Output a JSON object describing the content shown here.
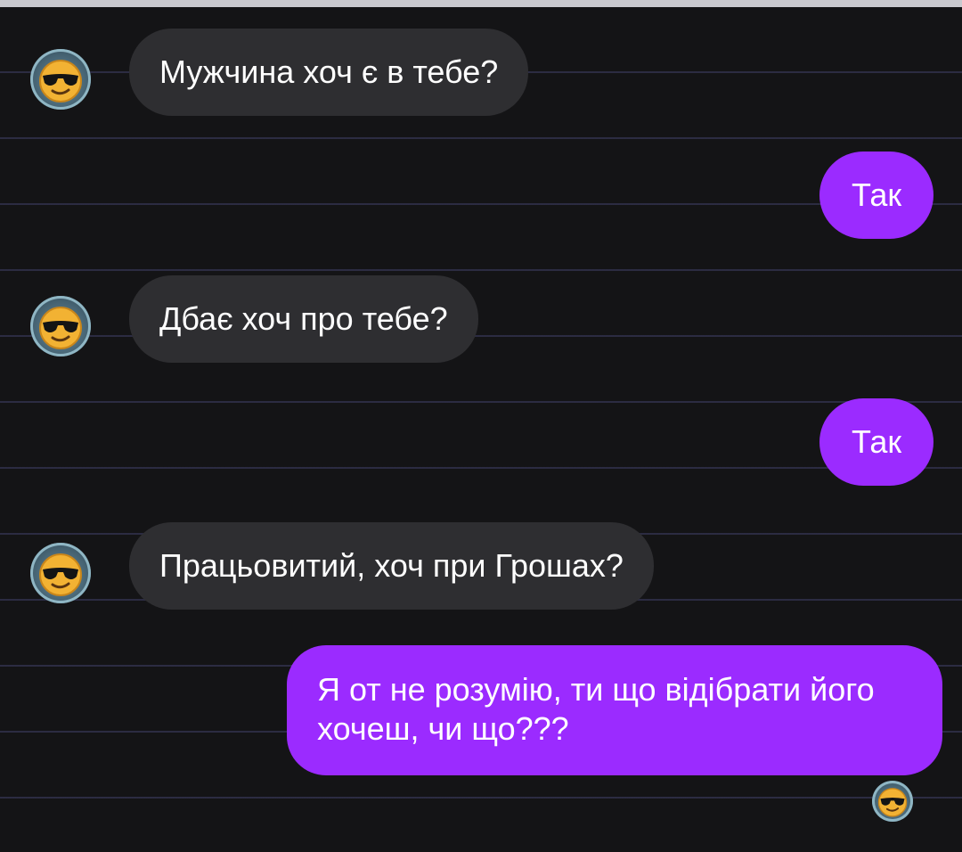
{
  "chat": {
    "messages": [
      {
        "side": "incoming",
        "text": "Мужчина хоч є в тебе?"
      },
      {
        "side": "outgoing",
        "text": "Так"
      },
      {
        "side": "incoming",
        "text": "Дбає хоч про тебе?"
      },
      {
        "side": "outgoing",
        "text": "Так"
      },
      {
        "side": "incoming",
        "text": "Працьовитий, хоч при Грошах?"
      },
      {
        "side": "outgoing",
        "text": "Я от не розумію, ти що відібрати його хочеш, чи що???"
      }
    ],
    "contact_avatar_icon": "sunglasses-emoji-icon",
    "seen_avatar_icon": "sunglasses-emoji-icon"
  },
  "colors": {
    "background": "#141416",
    "incoming_bubble": "#2e2e31",
    "outgoing_bubble": "#9b2bff",
    "text": "#ffffff"
  }
}
